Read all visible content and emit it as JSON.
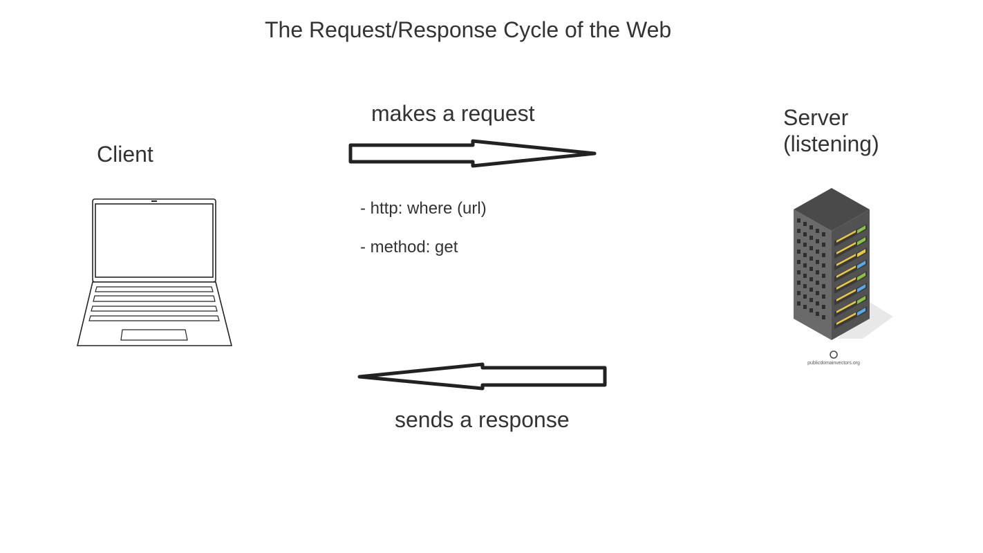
{
  "title": "The Request/Response Cycle of the Web",
  "client": {
    "label": "Client"
  },
  "server": {
    "label_line1": "Server",
    "label_line2": "(listening)",
    "credit": "publicdomainvectors.org"
  },
  "request": {
    "label": "makes a request",
    "details": [
      "- http: where (url)",
      "- method: get"
    ]
  },
  "response": {
    "label": "sends a response"
  },
  "colors": {
    "text": "#333333",
    "arrow_stroke": "#222222",
    "server_body": "#555555",
    "server_top": "#444444",
    "led_yellow": "#e8c84a",
    "led_green": "#8bc34a",
    "led_blue": "#5aa9e6"
  },
  "icons": [
    "laptop-icon",
    "server-rack-icon",
    "right-arrow",
    "left-arrow"
  ]
}
